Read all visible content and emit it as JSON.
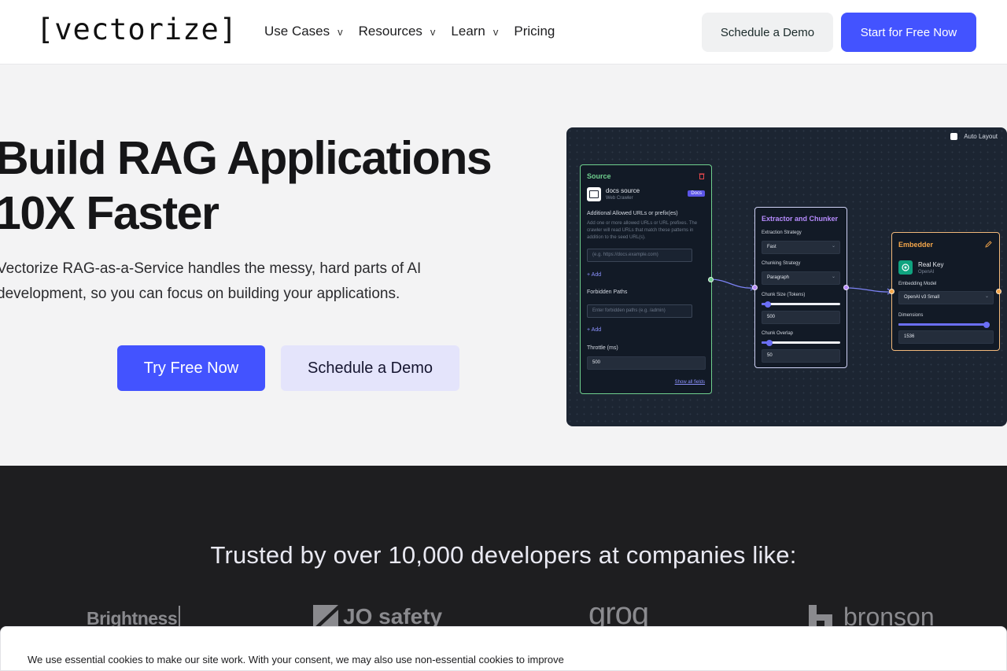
{
  "nav": {
    "logo": "[vectorize]",
    "menu": [
      {
        "label": "Use Cases",
        "chevron": "v"
      },
      {
        "label": "Resources",
        "chevron": "v"
      },
      {
        "label": "Learn",
        "chevron": "v"
      },
      {
        "label": "Pricing",
        "chevron": ""
      }
    ],
    "schedule_demo": "Schedule a Demo",
    "start_free": "Start for Free Now"
  },
  "hero": {
    "title_line1": "Build RAG Applications",
    "title_line2": "10X Faster",
    "subtitle_line1": "Vectorize RAG-as-a-Service handles the messy, hard parts of AI",
    "subtitle_line2": "development, so you can focus on building your applications.",
    "try_free": "Try Free Now",
    "schedule_demo": "Schedule a Demo"
  },
  "pipeline": {
    "auto_layout": "Auto Layout",
    "source": {
      "title": "Source",
      "name": "docs source",
      "type": "Web Crawler",
      "badge": "Docs",
      "allowed_label": "Additional Allowed URLs or prefix(es)",
      "allowed_hint": "Add one or more allowed URLs or URL prefixes. The crawler will read URLs that match these patterns in addition to the seed URL(s).",
      "allowed_placeholder": "(e.g. https://docs.example.com)",
      "add1": "+ Add",
      "forbidden_label": "Forbidden Paths",
      "forbidden_placeholder": "Enter forbidden paths (e.g. /admin)",
      "add2": "+ Add",
      "throttle_label": "Throttle (ms)",
      "throttle_value": "500",
      "show_all": "Show all fields"
    },
    "extractor": {
      "title": "Extractor and Chunker",
      "strategy_label": "Extraction Strategy",
      "strategy_value": "Fast",
      "chunking_label": "Chunking Strategy",
      "chunking_value": "Paragraph",
      "chunk_size_label": "Chunk Size (Tokens)",
      "chunk_size_value": "500",
      "chunk_size_fraction": 0.08,
      "overlap_label": "Chunk Overlap",
      "overlap_value": "50",
      "overlap_fraction": 0.1
    },
    "embedder": {
      "title": "Embedder",
      "key_name": "Real Key",
      "provider": "OpenAI",
      "model_label": "Embedding Model",
      "model_value": "OpenAI v3 Small",
      "dimensions_label": "Dimensions",
      "dimensions_value": "1536",
      "dimensions_fraction": 1.0
    }
  },
  "trusted": {
    "title": "Trusted by over 10,000 developers at companies like:",
    "logos": [
      "Brightness",
      "JO safety",
      "groq",
      "bronson"
    ]
  },
  "cookie": {
    "text": "We use essential cookies to make our site work. With your consent, we may also use non-essential cookies to improve user"
  },
  "colors": {
    "accent": "#4353ff",
    "source_border": "#6fcf8e",
    "extractor_title": "#b78cff",
    "embedder_title": "#f4a64a",
    "source_title": "#6fcf8e"
  }
}
